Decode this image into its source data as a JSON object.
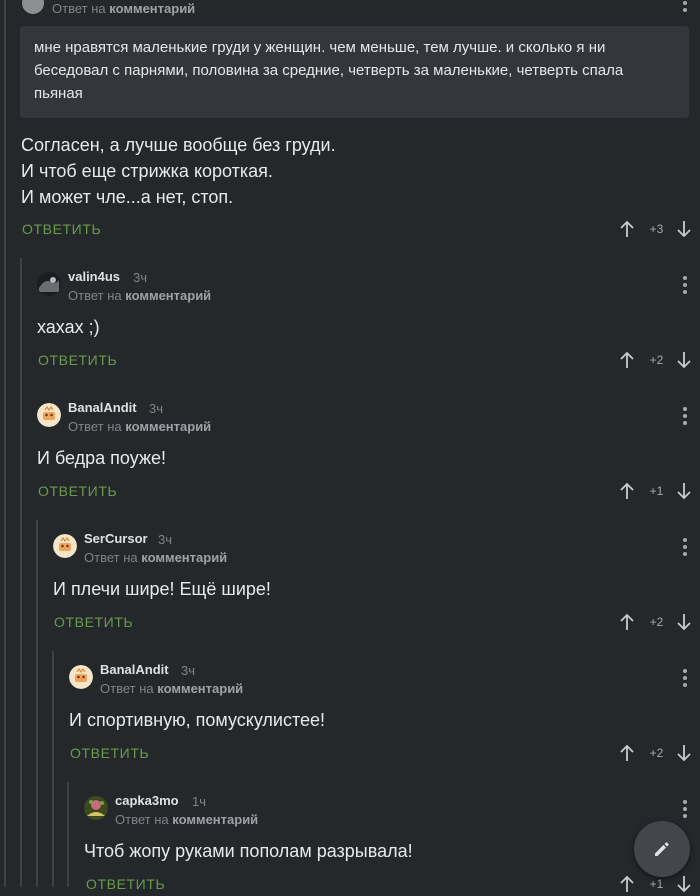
{
  "top_comment": {
    "reply_to_prefix": "Ответ на",
    "reply_to_link": "комментарий",
    "quote": "мне нравятся маленькие груди у женщин. чем меньше, тем лучше. и сколько я ни беседовал с парнями, половина за средние, четверть за маленькие, четверть спала пьяная",
    "lines": [
      "Согласен, а лучше вообще без груди.",
      "И чтоб еще стрижка короткая.",
      "И может чле...а нет, стоп."
    ],
    "reply_label": "ОТВЕТИТЬ",
    "score": "+3"
  },
  "comments": [
    {
      "nick": "valin4us",
      "time": "3ч",
      "reply_to_prefix": "Ответ на",
      "reply_to_link": "комментарий",
      "text": "хахах ;)",
      "reply_label": "ОТВЕТИТЬ",
      "score": "+2"
    },
    {
      "nick": "BanalAndit",
      "time": "3ч",
      "reply_to_prefix": "Ответ на",
      "reply_to_link": "комментарий",
      "text": "И бедра поуже!",
      "reply_label": "ОТВЕТИТЬ",
      "score": "+1"
    },
    {
      "nick": "SerCursor",
      "time": "3ч",
      "reply_to_prefix": "Ответ на",
      "reply_to_link": "комментарий",
      "text": "И плечи шире! Ещё шире!",
      "reply_label": "ОТВЕТИТЬ",
      "score": "+2"
    },
    {
      "nick": "BanalAndit",
      "time": "3ч",
      "reply_to_prefix": "Ответ на",
      "reply_to_link": "комментарий",
      "text": "И спортивную, помускулистее!",
      "reply_label": "ОТВЕТИТЬ",
      "score": "+2"
    },
    {
      "nick": "capka3mo",
      "time": "1ч",
      "reply_to_prefix": "Ответ на",
      "reply_to_link": "комментарий",
      "text": "Чтоб жопу руками пополам разрывала!",
      "reply_label": "ОТВЕТИТЬ",
      "score": "+1"
    }
  ],
  "icons": {
    "upvote": "arrow-up-icon",
    "downvote": "arrow-down-icon",
    "menu": "kebab-menu-icon",
    "compose": "pencil-icon"
  },
  "colors": {
    "background": "#25282b",
    "quote_background": "#33363a",
    "reply_green": "#6a9a4d",
    "thread_line": "#3d4145"
  }
}
